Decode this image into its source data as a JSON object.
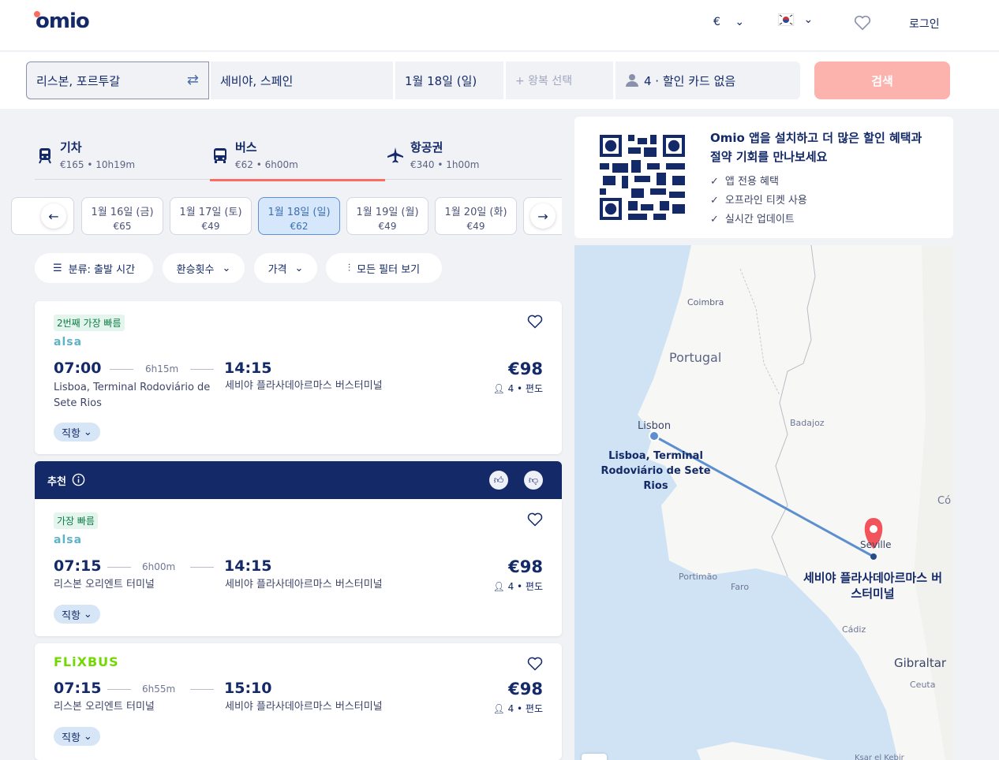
{
  "header": {
    "logo": "omio",
    "currency": "€",
    "login": "로그인"
  },
  "search": {
    "origin": "리스본, 포르투갈",
    "destination": "세비야, 스페인",
    "date": "1월 18일 (일)",
    "return_placeholder": "+ 왕복 선택",
    "passengers": "4 · 할인 카드 없음",
    "button": "검색"
  },
  "tabs": [
    {
      "label": "기차",
      "sub": "€165 • 10h19m"
    },
    {
      "label": "버스",
      "sub": "€62 • 6h00m"
    },
    {
      "label": "항공권",
      "sub": "€340 • 1h00m"
    }
  ],
  "dates": [
    {
      "label": "1월 16일 (금)",
      "price": "€65"
    },
    {
      "label": "1월 17일 (토)",
      "price": "€49"
    },
    {
      "label": "1월 18일 (일)",
      "price": "€62"
    },
    {
      "label": "1월 19일 (월)",
      "price": "€49"
    },
    {
      "label": "1월 20일 (화)",
      "price": "€49"
    }
  ],
  "filters": {
    "sort": "분류: 출발 시간",
    "transfers": "환승횟수",
    "price": "가격",
    "all": "모든 필터 보기"
  },
  "recommend": {
    "label": "추천"
  },
  "results": [
    {
      "badge": "2번째 가장 빠름",
      "carrier": "alsa",
      "dep": "07:00",
      "dur": "6h15m",
      "arr": "14:15",
      "from": "Lisboa, Terminal Rodoviário de Sete Rios",
      "to": "세비야 플라사데아르마스 버스터미널",
      "price": "€98",
      "pax": "4 • 편도",
      "direct": "직항"
    },
    {
      "badge": "가장 빠름",
      "carrier": "alsa",
      "dep": "07:15",
      "dur": "6h00m",
      "arr": "14:15",
      "from": "리스본 오리엔트 터미널",
      "to": "세비야 플라사데아르마스 버스터미널",
      "price": "€98",
      "pax": "4 • 편도",
      "direct": "직항"
    },
    {
      "badge": "",
      "carrier": "FLiXBUS",
      "dep": "07:15",
      "dur": "6h55m",
      "arr": "15:10",
      "from": "리스본 오리엔트 터미널",
      "to": "세비야 플라사데아르마스 버스터미널",
      "price": "€98",
      "pax": "4 • 편도",
      "direct": "직항"
    }
  ],
  "promo": {
    "title": "Omio 앱을 설치하고 더 많은 할인 혜택과 절약 기회를 만나보세요",
    "items": [
      "앱 전용 혜택",
      "오프라인 티켓 사용",
      "실시간 업데이트"
    ]
  },
  "map": {
    "labels": {
      "coimbra": "Coimbra",
      "portugal": "Portugal",
      "lisbon": "Lisbon",
      "badajoz": "Badajoz",
      "co": "Có",
      "seville": "Seville",
      "portimao": "Portimão",
      "faro": "Faro",
      "cadiz": "Cádiz",
      "gibraltar": "Gibraltar",
      "ceuta": "Ceuta",
      "ksar": "Ksar el Kebir"
    },
    "origin_label": "Lisboa, Terminal Rodoviário de Sete Rios",
    "dest_label": "세비야 플라사데아르마스 버스터미널"
  }
}
